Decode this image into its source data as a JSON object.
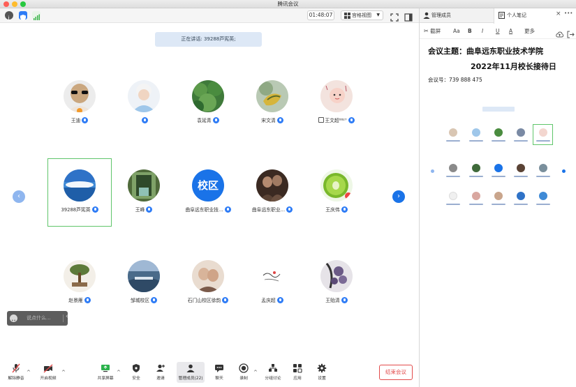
{
  "window": {
    "title": "腾讯会议"
  },
  "topbar": {
    "timer": "01:48:07",
    "view_mode": "宫格视图"
  },
  "speaking": {
    "label": "正在讲话: 39288芦宪英;"
  },
  "participants": [
    {
      "name": "王迪"
    },
    {
      "name": ""
    },
    {
      "name": "袁延青"
    },
    {
      "name": "宋文清"
    },
    {
      "name": "王文超⁸⁸²⁷"
    },
    {
      "name": "39288芦宪英"
    },
    {
      "name": "王峰"
    },
    {
      "name": "曲阜远东职业技..."
    },
    {
      "name": "曲阜远东职业..."
    },
    {
      "name": "王庆伟"
    },
    {
      "name": "赵景雁"
    },
    {
      "name": "邹城校区"
    },
    {
      "name": "石门山校区徐韵"
    },
    {
      "name": "孟庆超"
    },
    {
      "name": "王贻清"
    }
  ],
  "campus_avatar_text": "校区",
  "chat": {
    "placeholder": "说点什么..."
  },
  "toolbar": {
    "items": [
      {
        "label": "解除静音"
      },
      {
        "label": "开启视频"
      },
      {
        "label": "共享屏幕"
      },
      {
        "label": "安全"
      },
      {
        "label": "邀请"
      },
      {
        "label": "管理成员(22)"
      },
      {
        "label": "聊天"
      },
      {
        "label": "录制"
      },
      {
        "label": "分组讨论"
      },
      {
        "label": "应用"
      },
      {
        "label": "设置"
      }
    ],
    "end_label": "结束会议"
  },
  "panel": {
    "tab_members": "管理成员",
    "tab_notes": "个人笔记",
    "note_toolbar": {
      "screenshot": "截屏",
      "font": "Aa",
      "bold": "B",
      "italic": "I",
      "underline": "U",
      "color": "A",
      "more": "更多"
    },
    "note": {
      "title_line1": "会议主题：曲阜远东职业技术学院",
      "title_line2": "2022年11月校长接待日",
      "meeting_no": "会议号：739 888 475"
    }
  },
  "colors": {
    "accent": "#2e7cf6",
    "end_red": "#e24a4a",
    "selected_green": "#5fc56a"
  }
}
